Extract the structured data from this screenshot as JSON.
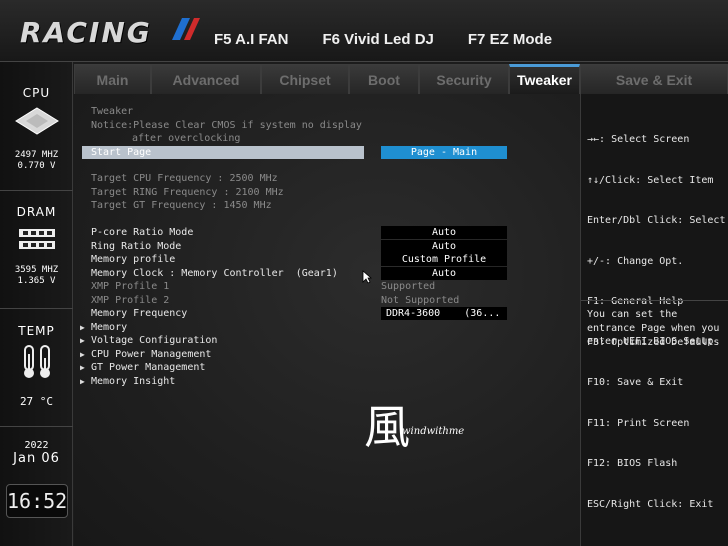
{
  "header": {
    "logo": "RACING",
    "hotkeys": [
      "F5 A.I FAN",
      "F6 Vivid Led DJ",
      "F7 EZ Mode"
    ]
  },
  "sidebar": {
    "cpu": {
      "title": "CPU",
      "freq": "2497 MHZ",
      "volt": "0.770 V"
    },
    "dram": {
      "title": "DRAM",
      "freq": "3595 MHZ",
      "volt": "1.365 V"
    },
    "temp": {
      "title": "TEMP",
      "value": "27 °C"
    },
    "date": {
      "year": "2022",
      "monthday": "Jan 06"
    },
    "time": "16:52"
  },
  "tabs": [
    {
      "label": "Main",
      "active": false
    },
    {
      "label": "Advanced",
      "active": false
    },
    {
      "label": "Chipset",
      "active": false
    },
    {
      "label": "Boot",
      "active": false
    },
    {
      "label": "Security",
      "active": false
    },
    {
      "label": "Tweaker",
      "active": true
    },
    {
      "label": "Save & Exit",
      "active": false
    }
  ],
  "main": {
    "section_title": "Tweaker",
    "notice_line1": "Notice:Please Clear CMOS if system no display",
    "notice_line2": "after overclocking",
    "start_page_label": "Start Page",
    "start_page_value": "Page - Main",
    "target_cpu": "Target CPU Frequency : 2500 MHz",
    "target_ring": "Target RING Frequency : 2100 MHz",
    "target_gt": "Target GT Frequency : 1450 MHz",
    "settings": [
      {
        "label": "P-core Ratio Mode",
        "value": "Auto"
      },
      {
        "label": "Ring Ratio Mode",
        "value": "Auto"
      },
      {
        "label": "Memory profile",
        "value": "Custom Profile"
      },
      {
        "label": "Memory Clock : Memory Controller  (Gear1)",
        "value": "Auto"
      }
    ],
    "xmp1_label": "XMP Profile 1",
    "xmp1_value": "Supported",
    "xmp2_label": "XMP Profile 2",
    "xmp2_value": "Not Supported",
    "memfreq_label": "Memory Frequency",
    "memfreq_value": "DDR4-3600    (36...",
    "submenus": [
      "Memory",
      "Voltage Configuration",
      "CPU Power Management",
      "GT Power Management",
      "Memory Insight"
    ],
    "watermark_char": "風",
    "watermark_text": "windwithme"
  },
  "help": {
    "keys": [
      "→←: Select Screen",
      "↑↓/Click: Select Item",
      "Enter/Dbl Click: Select",
      "+/-: Change Opt.",
      "F1: General Help",
      "F3: Optimized Defaults",
      "F10: Save & Exit",
      "F11: Print Screen",
      "F12: BIOS Flash",
      "ESC/Right Click: Exit"
    ],
    "description": "You can set the entrance Page when you enter UEFI BIOS Setup"
  },
  "colors": {
    "accent": "#1f8fd1",
    "highlight": "#b9c2cc",
    "tab_active_top": "#4a9ad6"
  }
}
